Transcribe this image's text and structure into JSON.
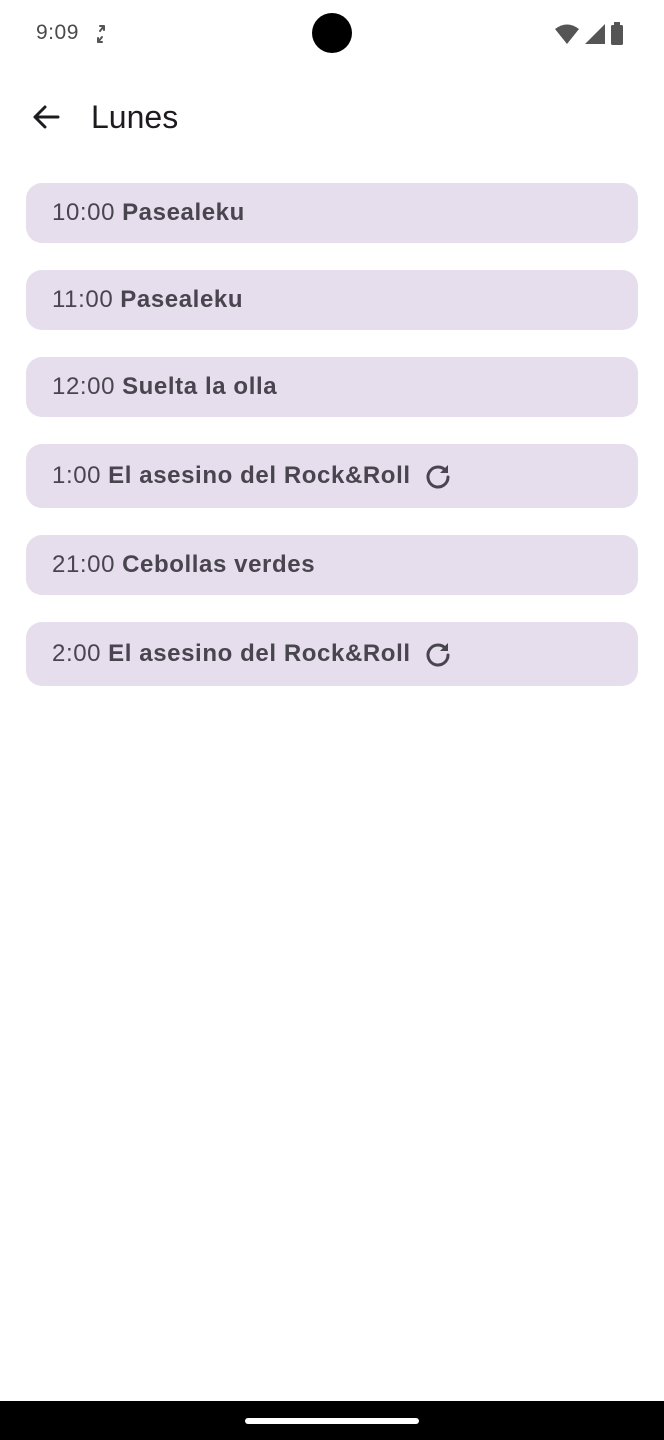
{
  "status_bar": {
    "time": "9:09",
    "sync_icon": "sync-off-icon",
    "wifi_icon": "wifi-icon",
    "signal_icon": "cell-signal-icon",
    "battery_icon": "battery-icon"
  },
  "app_bar": {
    "back_icon": "arrow-back-icon",
    "title": "Lunes"
  },
  "schedule": [
    {
      "time": "10:00",
      "show": "Pasealeku",
      "rerun": false
    },
    {
      "time": "11:00",
      "show": "Pasealeku",
      "rerun": false
    },
    {
      "time": "12:00",
      "show": "Suelta la olla",
      "rerun": false
    },
    {
      "time": "1:00",
      "show": "El asesino del Rock&Roll",
      "rerun": true
    },
    {
      "time": "21:00",
      "show": "Cebollas verdes",
      "rerun": false
    },
    {
      "time": "2:00",
      "show": "El asesino del Rock&Roll",
      "rerun": true
    }
  ],
  "colors": {
    "item_background": "#e6deec",
    "item_text": "#49454f",
    "title_text": "#1d1b20"
  }
}
